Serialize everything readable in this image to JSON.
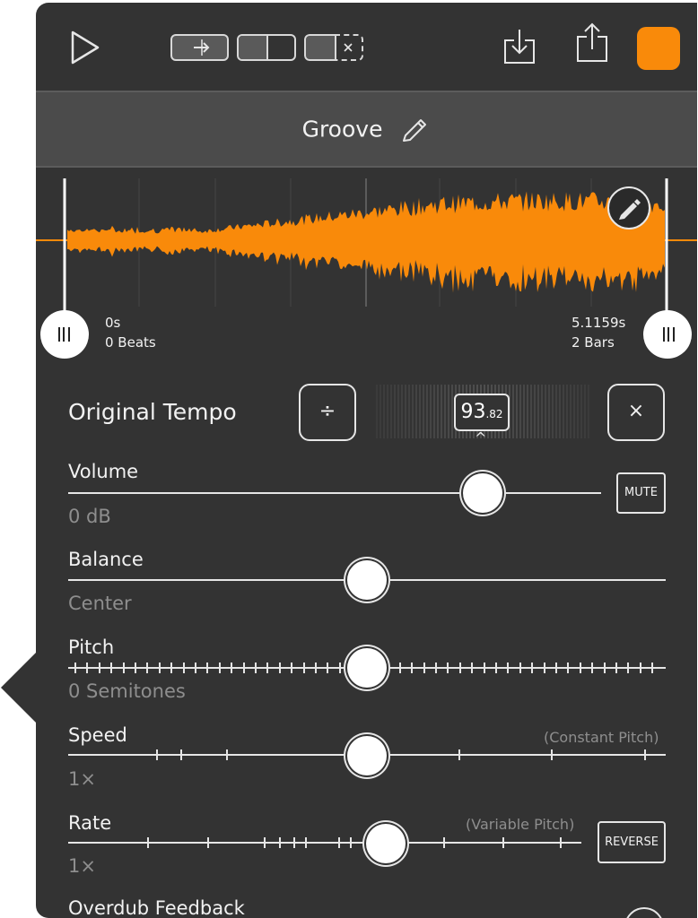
{
  "colors": {
    "accent": "#f98a0a",
    "panel": "#333333",
    "title_bar": "#4b4b4b"
  },
  "toolbar": {
    "play_icon": "play-icon",
    "modes": [
      "mode-through-icon",
      "mode-split-icon",
      "mode-clear-icon"
    ],
    "import_icon": "import-icon",
    "share_icon": "share-icon",
    "color_swatch": "#f98a0a"
  },
  "title": {
    "text": "Groove",
    "edit_icon": "pencil-icon"
  },
  "waveform": {
    "start_time": "0s",
    "start_beats": "0 Beats",
    "end_time": "5.1159s",
    "end_bars": "2 Bars",
    "edit_icon": "pencil-icon"
  },
  "tempo": {
    "label": "Original Tempo",
    "halve_label": "÷",
    "double_label": "×",
    "value_int": "93",
    "value_frac": ".82",
    "caret": "^"
  },
  "volume": {
    "label": "Volume",
    "value": "0 dB",
    "mute_label": "MUTE",
    "level": 0.78
  },
  "balance": {
    "label": "Balance",
    "value": "Center",
    "level": 0.5
  },
  "pitch": {
    "label": "Pitch",
    "value": "0 Semitones",
    "level": 0.5
  },
  "speed": {
    "label": "Speed",
    "value": "1×",
    "note": "(Constant Pitch)",
    "level": 0.5
  },
  "rate": {
    "label": "Rate",
    "value": "1×",
    "note": "(Variable Pitch)",
    "reverse_label": "REVERSE",
    "level": 0.62
  },
  "overdub": {
    "label": "Overdub Feedback"
  }
}
